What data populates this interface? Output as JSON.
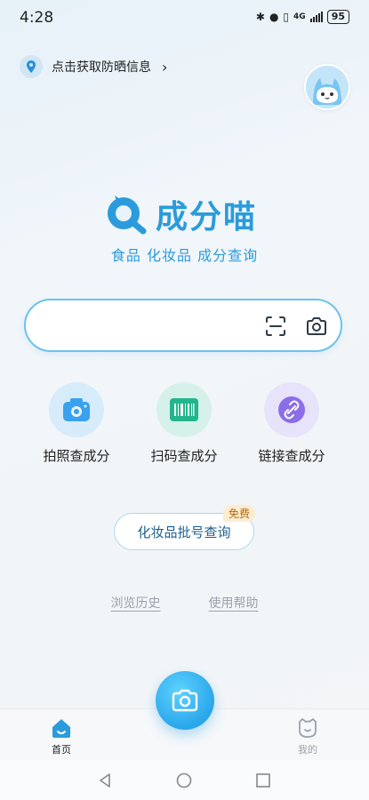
{
  "status_bar": {
    "time": "4:28",
    "battery": "95",
    "network": "4G"
  },
  "location": {
    "label": "点击获取防晒信息",
    "chevron": "›"
  },
  "app": {
    "name": "成分喵",
    "tagline": "食品 化妆品 成分查询"
  },
  "search": {
    "placeholder": "",
    "value": ""
  },
  "features": [
    {
      "label": "拍照查成分",
      "icon": "camera-icon"
    },
    {
      "label": "扫码查成分",
      "icon": "barcode-icon"
    },
    {
      "label": "链接查成分",
      "icon": "link-icon"
    }
  ],
  "batch": {
    "label": "化妆品批号查询",
    "badge": "免费"
  },
  "links": {
    "history": "浏览历史",
    "help": "使用帮助"
  },
  "tabbar": {
    "home": "首页",
    "mine": "我的"
  },
  "colors": {
    "accent": "#2b9bdb",
    "search_border": "#6bc2ee",
    "badge_bg": "#fcecd0"
  }
}
